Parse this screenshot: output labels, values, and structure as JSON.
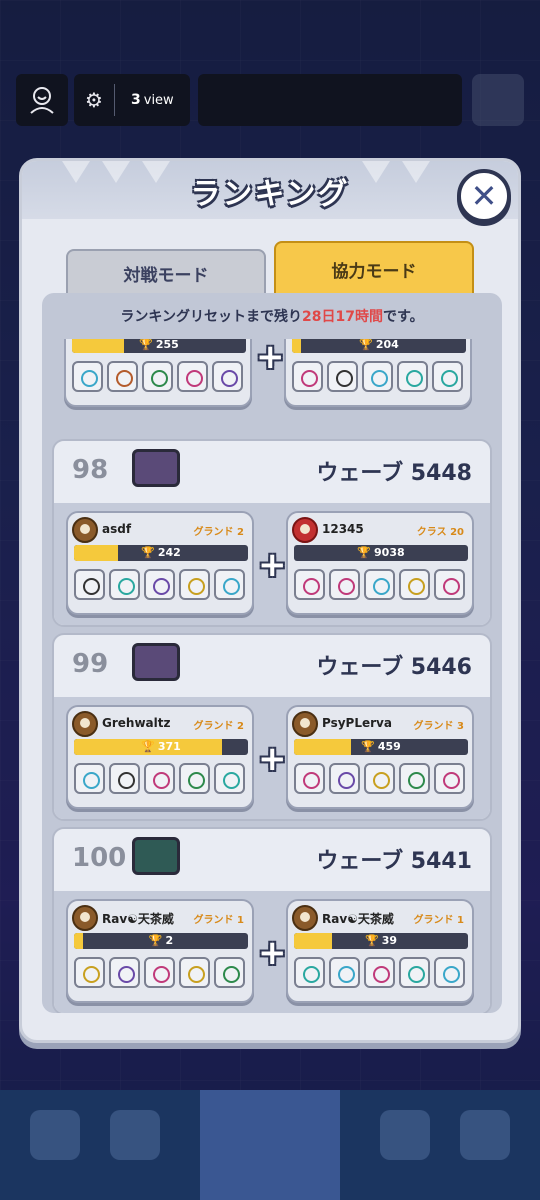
{
  "top_bar": {
    "view_count_num": "3",
    "view_count_label": "view"
  },
  "modal": {
    "title": "ランキング",
    "tabs": {
      "pvp": "対戦モード",
      "coop": "協力モード"
    },
    "reset_prefix": "ランキングリセットまで残り",
    "reset_time": "28日17時間",
    "reset_suffix": "です。"
  },
  "partial_entry": {
    "left": {
      "trophies": "255",
      "trophy_fraction": 0.3
    },
    "right": {
      "trophies": "204",
      "trophy_fraction": 0.05
    }
  },
  "entries": [
    {
      "rank": "98",
      "wave": "ウェーブ 5448",
      "left": {
        "name": "asdf",
        "class": "グランド 2",
        "trophies": "242",
        "trophy_fraction": 0.25
      },
      "right": {
        "name": "12345",
        "class": "クラス 20",
        "trophies": "9038",
        "trophy_fraction": 0.0
      }
    },
    {
      "rank": "99",
      "wave": "ウェーブ 5446",
      "left": {
        "name": "Grehwaltz",
        "class": "グランド 2",
        "trophies": "371",
        "trophy_fraction": 0.85
      },
      "right": {
        "name": "PsyPLerva",
        "class": "グランド 3",
        "trophies": "459",
        "trophy_fraction": 0.33
      }
    },
    {
      "rank": "100",
      "wave": "ウェーブ 5441",
      "left": {
        "name": "Rav☯天茶威",
        "class": "グランド 1",
        "trophies": "2",
        "trophy_fraction": 0.05
      },
      "right": {
        "name": "Rav☯天茶威",
        "class": "グランド 1",
        "trophies": "39",
        "trophy_fraction": 0.22
      }
    }
  ]
}
